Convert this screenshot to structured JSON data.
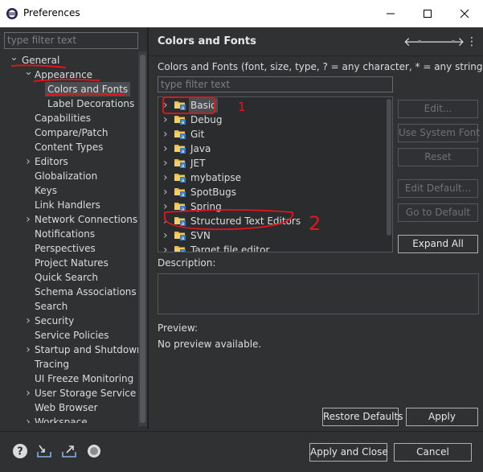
{
  "window": {
    "title": "Preferences"
  },
  "left": {
    "filter_placeholder": "type filter text",
    "tree": [
      {
        "label": "General",
        "level": 0,
        "arrow": "down"
      },
      {
        "label": "Appearance",
        "level": 1,
        "arrow": "down"
      },
      {
        "label": "Colors and Fonts",
        "level": 2,
        "arrow": "none",
        "selected": true
      },
      {
        "label": "Label Decorations",
        "level": 2,
        "arrow": "none"
      },
      {
        "label": "Capabilities",
        "level": 1,
        "arrow": "none"
      },
      {
        "label": "Compare/Patch",
        "level": 1,
        "arrow": "none"
      },
      {
        "label": "Content Types",
        "level": 1,
        "arrow": "none"
      },
      {
        "label": "Editors",
        "level": 1,
        "arrow": "right"
      },
      {
        "label": "Globalization",
        "level": 1,
        "arrow": "none"
      },
      {
        "label": "Keys",
        "level": 1,
        "arrow": "none"
      },
      {
        "label": "Link Handlers",
        "level": 1,
        "arrow": "none"
      },
      {
        "label": "Network Connections",
        "level": 1,
        "arrow": "right"
      },
      {
        "label": "Notifications",
        "level": 1,
        "arrow": "none"
      },
      {
        "label": "Perspectives",
        "level": 1,
        "arrow": "none"
      },
      {
        "label": "Project Natures",
        "level": 1,
        "arrow": "none"
      },
      {
        "label": "Quick Search",
        "level": 1,
        "arrow": "none"
      },
      {
        "label": "Schema Associations",
        "level": 1,
        "arrow": "none"
      },
      {
        "label": "Search",
        "level": 1,
        "arrow": "none"
      },
      {
        "label": "Security",
        "level": 1,
        "arrow": "right"
      },
      {
        "label": "Service Policies",
        "level": 1,
        "arrow": "none"
      },
      {
        "label": "Startup and Shutdown",
        "level": 1,
        "arrow": "right"
      },
      {
        "label": "Tracing",
        "level": 1,
        "arrow": "none"
      },
      {
        "label": "UI Freeze Monitoring",
        "level": 1,
        "arrow": "none"
      },
      {
        "label": "User Storage Service",
        "level": 1,
        "arrow": "right"
      },
      {
        "label": "Web Browser",
        "level": 1,
        "arrow": "none"
      },
      {
        "label": "Workspace",
        "level": 1,
        "arrow": "right"
      }
    ]
  },
  "header": {
    "title": "Colors and Fonts"
  },
  "main": {
    "description": "Colors and Fonts (font, size, type, ? = any character, * = any string) :",
    "filter_placeholder": "type filter text",
    "font_tree": [
      {
        "label": "Basic",
        "selected": true
      },
      {
        "label": "Debug"
      },
      {
        "label": "Git"
      },
      {
        "label": "Java"
      },
      {
        "label": "JET"
      },
      {
        "label": "mybatipse"
      },
      {
        "label": "SpotBugs"
      },
      {
        "label": "Spring"
      },
      {
        "label": "Structured Text Editors"
      },
      {
        "label": "SVN"
      },
      {
        "label": "Target file editor"
      }
    ],
    "buttons": {
      "edit": "Edit...",
      "use_system_font": "Use System Font",
      "reset": "Reset",
      "edit_default": "Edit Default...",
      "go_to_default": "Go to Default",
      "expand_all": "Expand All"
    },
    "description_label": "Description:",
    "preview_label": "Preview:",
    "preview_text": "No preview available.",
    "restore_defaults": "Restore Defaults",
    "apply": "Apply"
  },
  "footer": {
    "apply_and_close": "Apply and Close",
    "cancel": "Cancel"
  },
  "annotations": {
    "mark_1": "1",
    "mark_2": "2"
  },
  "colors": {
    "annotation_red": "#e8141c",
    "background": "#2f3133",
    "selected": "#4b4e51"
  }
}
